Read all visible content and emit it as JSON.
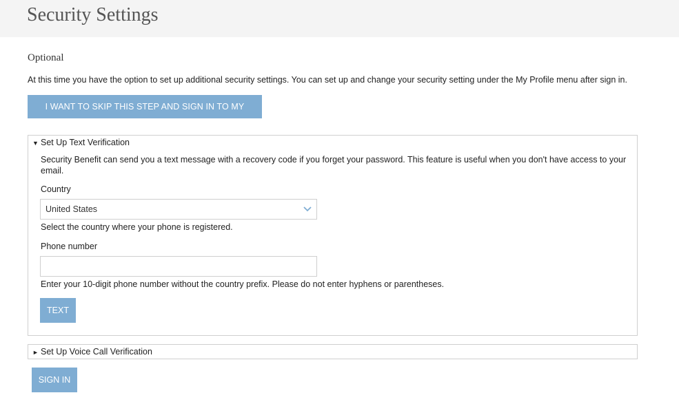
{
  "header": {
    "title": "Security Settings"
  },
  "intro": {
    "subtitle": "Optional",
    "text": "At this time you have the option to set up additional security settings. You can set up and change your security setting under the My Profile menu after sign in."
  },
  "skip_button": {
    "label": "I WANT TO SKIP THIS STEP AND SIGN IN TO MY ACCOUNT"
  },
  "text_verification": {
    "expanded": true,
    "summary_icon": "▼",
    "summary": "Set Up Text Verification",
    "description": "Security Benefit can send you a text message with a recovery code if you forget your password. This feature is useful when you don't have access to your email.",
    "country_label": "Country",
    "country_value": "United States",
    "country_hint": "Select the country where your phone is registered.",
    "phone_label": "Phone number",
    "phone_value": "",
    "phone_hint": "Enter your 10-digit phone number without the country prefix. Please do not enter hyphens or parentheses.",
    "button_label": "TEXT"
  },
  "voice_verification": {
    "expanded": false,
    "summary_icon": "►",
    "summary": "Set Up Voice Call Verification"
  },
  "signin_button": {
    "label": "SIGN IN"
  },
  "colors": {
    "accent": "#7fadd3",
    "header_bg": "#f4f4f4",
    "border": "#cfcfcf"
  }
}
